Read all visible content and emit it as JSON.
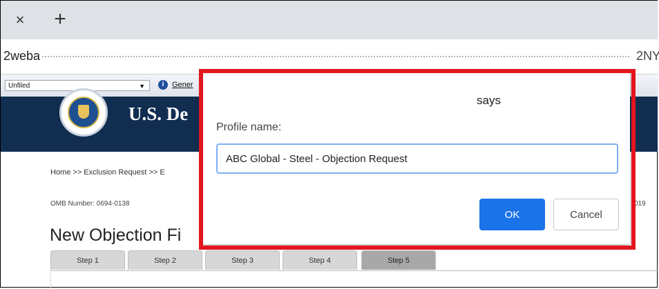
{
  "browser": {
    "tab_close_symbol": "×",
    "new_tab_symbol": "+",
    "url_left": "2weba",
    "url_right": "2NY"
  },
  "toolbar": {
    "folder": "Unfiled",
    "dropdown_arrow": "▼",
    "info_symbol": "i",
    "link": "Gener"
  },
  "page": {
    "agency": "U.S. De",
    "breadcrumb": "Home >> Exclusion Request >> E",
    "omb": "OMB Number: 0694-0138",
    "omb_right": "019",
    "title": "New Objection Fi",
    "steps": [
      "Step 1",
      "Step 2",
      "Step 3",
      "Step 4",
      "Step 5"
    ],
    "active_step": "Step 5"
  },
  "dialog": {
    "title": "says",
    "label": "Profile name:",
    "input_value": "ABC Global - Steel - Objection Request",
    "ok": "OK",
    "cancel": "Cancel"
  },
  "colors": {
    "banner": "#112e51",
    "highlight": "#e3161f",
    "ok_button": "#1a73e8"
  }
}
